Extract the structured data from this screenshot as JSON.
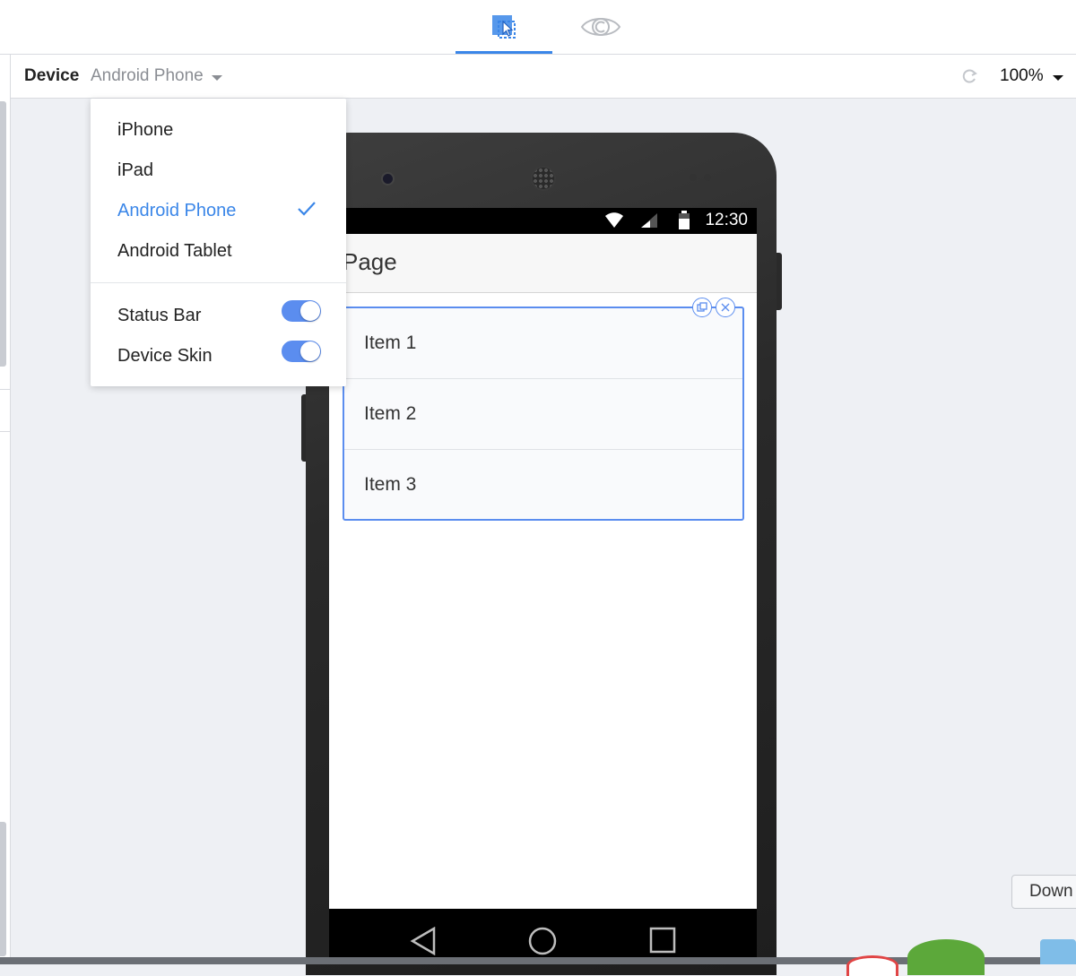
{
  "colors": {
    "accent": "#3a86e8",
    "toggle_on": "#5b8def",
    "phone_body": "#2a2a2a"
  },
  "mode_tabs": [
    {
      "name": "design",
      "icon": "select-cursor-icon",
      "active": true
    },
    {
      "name": "preview",
      "icon": "eye-icon",
      "active": false
    }
  ],
  "toolbar": {
    "device_label": "Device",
    "device_value": "Android Phone",
    "zoom": "100%",
    "rotate_icon": "rotate-icon"
  },
  "dropdown": {
    "devices": [
      "iPhone",
      "iPad",
      "Android Phone",
      "Android Tablet"
    ],
    "selected": "Android Phone",
    "toggles": [
      {
        "label": "Status Bar",
        "on": true
      },
      {
        "label": "Device Skin",
        "on": true
      }
    ]
  },
  "phone": {
    "status_time": "12:30",
    "page_title": "Page",
    "list_items": [
      "Item 1",
      "Item 2",
      "Item 3"
    ]
  },
  "download_tip": "Down"
}
